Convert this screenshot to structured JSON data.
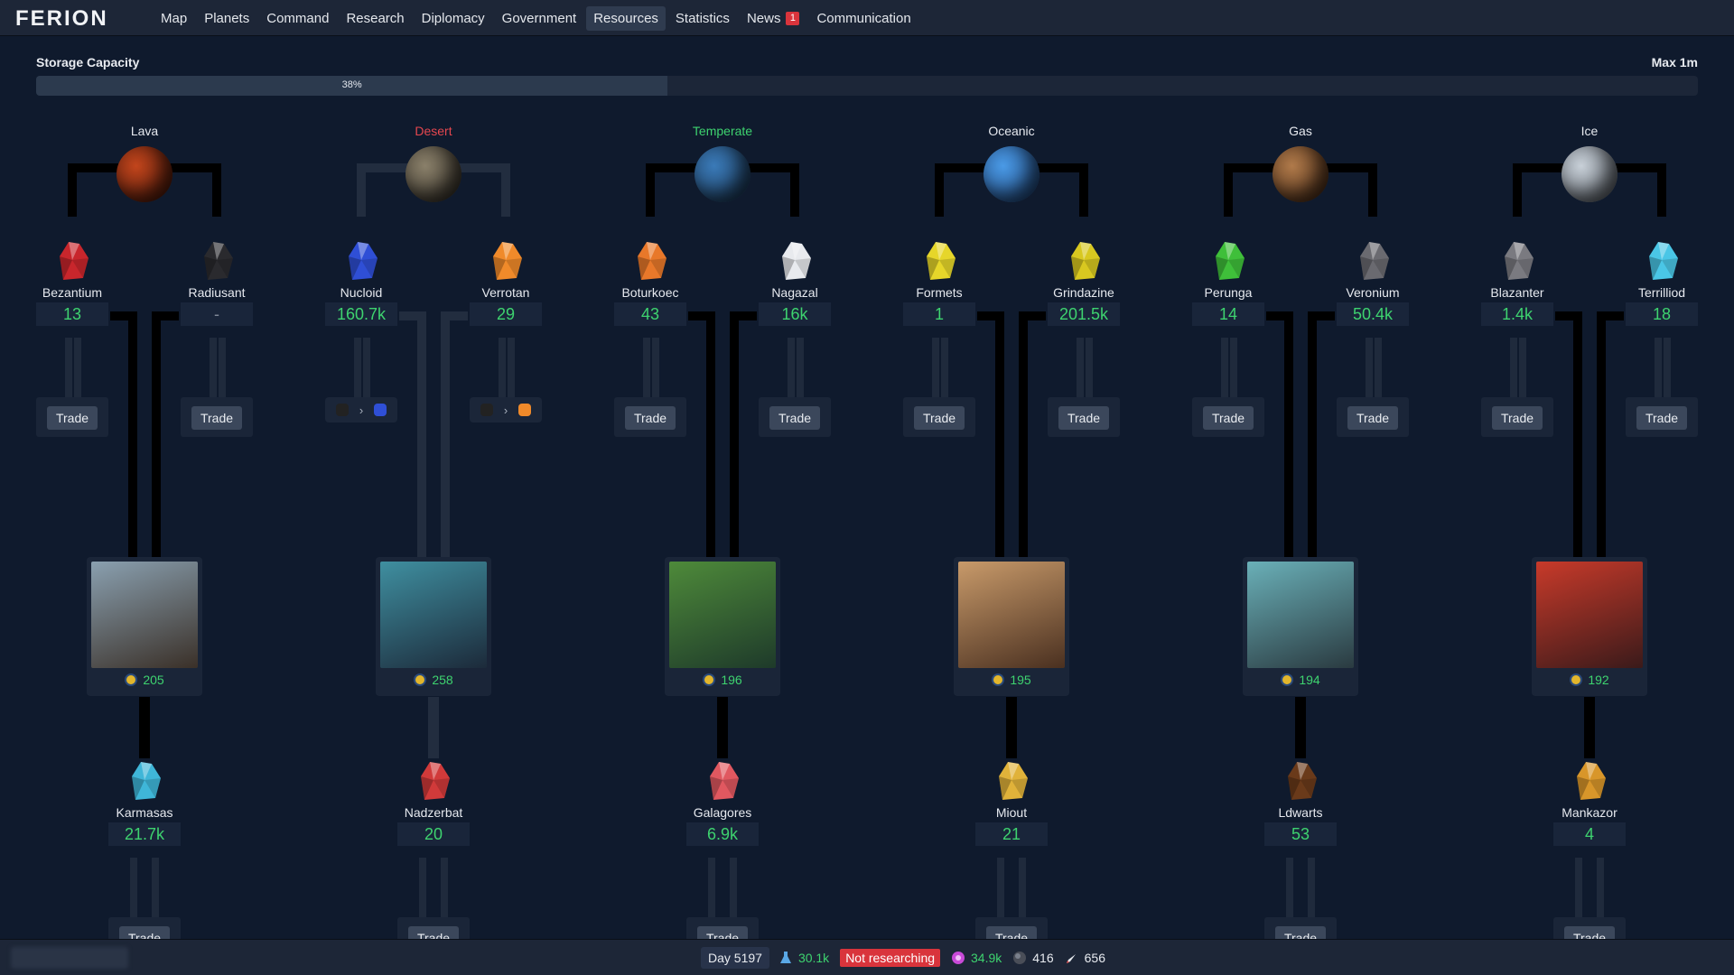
{
  "nav": {
    "logo": "FERION",
    "items": [
      {
        "label": "Map"
      },
      {
        "label": "Planets"
      },
      {
        "label": "Command"
      },
      {
        "label": "Research"
      },
      {
        "label": "Diplomacy"
      },
      {
        "label": "Government"
      },
      {
        "label": "Resources",
        "active": true
      },
      {
        "label": "Statistics"
      },
      {
        "label": "News",
        "badge": "1"
      },
      {
        "label": "Communication"
      }
    ]
  },
  "storage": {
    "label": "Storage Capacity",
    "max": "Max 1m",
    "percent_text": "38%",
    "fill": 0.38
  },
  "columns": [
    {
      "type": "Lava",
      "type_color": "#e6e9ef",
      "planet_icon": "lava-planet",
      "planet_colors": [
        "#c2451c",
        "#3a1208"
      ],
      "resources": [
        {
          "name": "Bezantium",
          "amount": "13",
          "color": "#c8262c"
        },
        {
          "name": "Radiusant",
          "amount": "-",
          "color": "#2a2a2e"
        }
      ],
      "factory": {
        "level": "205",
        "colors": [
          "#8aa0b0",
          "#3a3028"
        ]
      },
      "product": {
        "name": "Karmasas",
        "amount": "21.7k",
        "color": "#3fb6d8",
        "icon": "cyan-crystal-icon"
      }
    },
    {
      "type": "Desert",
      "type_color": "#e5474f",
      "planet_icon": "desert-planet",
      "planet_colors": [
        "#8a806a",
        "#2a2620"
      ],
      "resources": [
        {
          "name": "Nucloid",
          "amount": "160.7k",
          "color": "#2f4fd6"
        },
        {
          "name": "Verrotan",
          "amount": "29",
          "color": "#f08a2a"
        }
      ],
      "factory": {
        "level": "258",
        "colors": [
          "#3f8fa0",
          "#1c2a3a"
        ]
      },
      "product": {
        "name": "Nadzerbat",
        "amount": "20",
        "color": "#d13a3a",
        "icon": "red-crystal-icon"
      }
    },
    {
      "type": "Temperate",
      "type_color": "#3ed36f",
      "planet_icon": "temperate-planet",
      "planet_colors": [
        "#3a7ab8",
        "#18304a"
      ],
      "resources": [
        {
          "name": "Boturkoec",
          "amount": "43",
          "color": "#e8782a"
        },
        {
          "name": "Nagazal",
          "amount": "16k",
          "color": "#e8eaee"
        }
      ],
      "factory": {
        "level": "196",
        "colors": [
          "#4e8a3a",
          "#1e3a2a"
        ]
      },
      "product": {
        "name": "Galagores",
        "amount": "6.9k",
        "color": "#e05860",
        "icon": "pink-crystal-icon"
      }
    },
    {
      "type": "Oceanic",
      "type_color": "#e6e9ef",
      "planet_icon": "oceanic-planet",
      "planet_colors": [
        "#4a9ae6",
        "#1a3a6a"
      ],
      "resources": [
        {
          "name": "Formets",
          "amount": "1",
          "color": "#e6d62a"
        },
        {
          "name": "Grindazine",
          "amount": "201.5k",
          "color": "#d8c820"
        }
      ],
      "factory": {
        "level": "195",
        "colors": [
          "#c89a6a",
          "#4a3020"
        ]
      },
      "product": {
        "name": "Miout",
        "amount": "21",
        "color": "#e0b23a",
        "icon": "box-icon"
      }
    },
    {
      "type": "Gas",
      "type_color": "#e6e9ef",
      "planet_icon": "gas-planet",
      "planet_colors": [
        "#b07a4a",
        "#3a2010"
      ],
      "resources": [
        {
          "name": "Perunga",
          "amount": "14",
          "color": "#3fbf3a"
        },
        {
          "name": "Veronium",
          "amount": "50.4k",
          "color": "#6a6a70"
        }
      ],
      "factory": {
        "level": "194",
        "colors": [
          "#6ab0b8",
          "#2a3a40"
        ]
      },
      "product": {
        "name": "Ldwarts",
        "amount": "53",
        "color": "#6a3a1a",
        "icon": "poop-icon"
      }
    },
    {
      "type": "Ice",
      "type_color": "#e6e9ef",
      "planet_icon": "ice-planet",
      "planet_colors": [
        "#c8d0d8",
        "#4a5058"
      ],
      "resources": [
        {
          "name": "Blazanter",
          "amount": "1.4k",
          "color": "#7a7a80"
        },
        {
          "name": "Terrilliod",
          "amount": "18",
          "color": "#4ac6e6"
        }
      ],
      "factory": {
        "level": "192",
        "colors": [
          "#c83a2a",
          "#3a1a1a"
        ]
      },
      "product": {
        "name": "Mankazor",
        "amount": "4",
        "color": "#d8962a",
        "icon": "money-bag-icon"
      }
    }
  ],
  "trade_label": "Trade",
  "bottom": {
    "day": "Day 5197",
    "research_points": "30.1k",
    "research_status": "Not researching",
    "credits": "34.9k",
    "planets": "416",
    "ships": "656"
  }
}
